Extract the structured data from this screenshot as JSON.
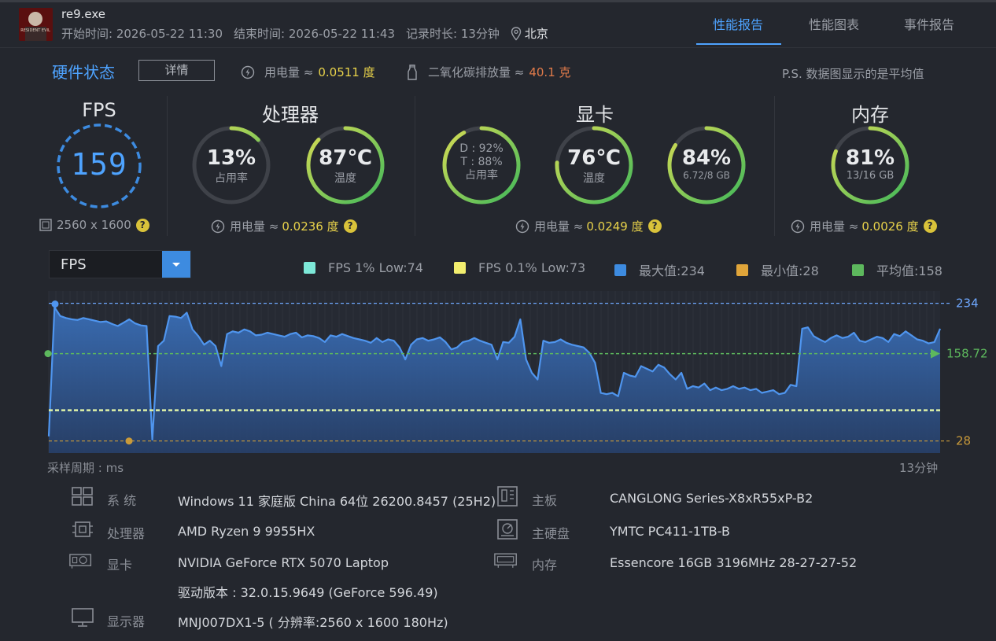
{
  "header": {
    "exe": "re9.exe",
    "thumbnail_text": "RESIDENT EVIL",
    "start_label": "开始时间: 2026-05-22 11:30",
    "end_label": "结束时间: 2026-05-22 11:43",
    "duration_label": "记录时长: 13分钟",
    "location": "北京",
    "tabs": [
      {
        "label": "性能报告",
        "active": true
      },
      {
        "label": "性能图表",
        "active": false
      },
      {
        "label": "事件报告",
        "active": false
      }
    ]
  },
  "hardware": {
    "title": "硬件状态",
    "detail_button": "详情",
    "power_label": "用电量 ≈",
    "power_value": "0.0511 度",
    "co2_label": "二氧化碳排放量 ≈",
    "co2_value": "40.1 克",
    "note": "P.S. 数据图显示的是平均值"
  },
  "fps": {
    "title": "FPS",
    "value": "159",
    "resolution": "2560 x 1600"
  },
  "cpu": {
    "title": "处理器",
    "usage_value": "13%",
    "usage_label": "占用率",
    "usage_fraction": 0.13,
    "temp_value": "87℃",
    "temp_label": "温度",
    "temp_fraction": 0.87,
    "power_label": "用电量 ≈",
    "power_value": "0.0236 度"
  },
  "gpu": {
    "title": "显卡",
    "usage_d": "D : 92%",
    "usage_t": "T : 88%",
    "usage_label": "占用率",
    "usage_fraction": 0.92,
    "temp_value": "76℃",
    "temp_label": "温度",
    "temp_fraction": 0.76,
    "mem_value": "84%",
    "mem_detail": "6.72/8 GB",
    "mem_fraction": 0.84,
    "power_label": "用电量 ≈",
    "power_value": "0.0249 度"
  },
  "ram": {
    "title": "内存",
    "value": "81%",
    "detail": "13/16 GB",
    "fraction": 0.81,
    "power_label": "用电量 ≈",
    "power_value": "0.0026 度"
  },
  "chart_controls": {
    "selected_metric": "FPS",
    "legend": [
      {
        "label": "FPS 1% Low:74",
        "color": "#7de8d8"
      },
      {
        "label": "FPS 0.1% Low:73",
        "color": "#f2ee6e"
      },
      {
        "label": "最大值:234",
        "color": "#3d8be0"
      },
      {
        "label": "最小值:28",
        "color": "#e0a53a"
      },
      {
        "label": "平均值:158",
        "color": "#5db85d"
      }
    ]
  },
  "chart_data": {
    "type": "area",
    "x_label": "采样周期 : ms",
    "x_end_label": "13分钟",
    "ylim": [
      10,
      250
    ],
    "max": 234,
    "min": 28,
    "avg": 158.72,
    "low_1": 74,
    "low_01": 73,
    "max_label": "234",
    "min_label": "28",
    "avg_label": "158.72",
    "values": [
      35,
      228,
      215,
      212,
      210,
      209,
      212,
      210,
      208,
      206,
      207,
      203,
      200,
      205,
      210,
      204,
      201,
      200,
      30,
      170,
      178,
      215,
      214,
      212,
      220,
      195,
      185,
      172,
      178,
      170,
      140,
      188,
      192,
      190,
      195,
      192,
      186,
      187,
      190,
      188,
      186,
      184,
      188,
      190,
      183,
      186,
      185,
      182,
      176,
      186,
      184,
      188,
      185,
      182,
      180,
      178,
      175,
      182,
      176,
      180,
      178,
      168,
      150,
      172,
      180,
      182,
      178,
      180,
      183,
      176,
      165,
      168,
      176,
      178,
      182,
      178,
      175,
      172,
      150,
      176,
      175,
      184,
      210,
      150,
      130,
      120,
      178,
      175,
      176,
      180,
      175,
      172,
      170,
      168,
      160,
      145,
      100,
      98,
      100,
      95,
      130,
      126,
      124,
      140,
      136,
      132,
      142,
      138,
      128,
      120,
      130,
      106,
      110,
      108,
      114,
      104,
      108,
      104,
      106,
      110,
      106,
      108,
      104,
      106,
      100,
      102,
      104,
      98,
      100,
      112,
      110,
      196,
      198,
      185,
      180,
      176,
      182,
      186,
      182,
      184,
      190,
      178,
      176,
      180,
      184,
      182,
      176,
      188,
      185,
      192,
      186,
      180,
      178,
      174,
      176,
      196
    ]
  },
  "system_info": [
    {
      "icon": "windows-icon",
      "label": "系 统",
      "value": "Windows 11 家庭版 China 64位 26200.8457 (25H2)"
    },
    {
      "icon": "motherboard-icon",
      "label": "主板",
      "value": "CANGLONG Series-X8xR55xP-B2"
    },
    {
      "icon": "cpu-icon",
      "label": "处理器",
      "value": "AMD Ryzen 9 9955HX"
    },
    {
      "icon": "disk-icon",
      "label": "主硬盘",
      "value": "YMTC PC411-1TB-B"
    },
    {
      "icon": "gpu-icon",
      "label": "显卡",
      "value": "NVIDIA GeForce RTX 5070 Laptop"
    },
    {
      "icon": "ram-icon",
      "label": "内存",
      "value": "Essencore 16GB 3196MHz 28-27-27-52"
    },
    {
      "icon": "driver",
      "label": "",
      "value": "驱动版本 : 32.0.15.9649 (GeForce 596.49)"
    },
    {
      "icon": "monitor-icon",
      "label": "显示器",
      "value": "MNJ007DX1-5 ( 分辨率:2560 x 1600 180Hz)"
    }
  ]
}
